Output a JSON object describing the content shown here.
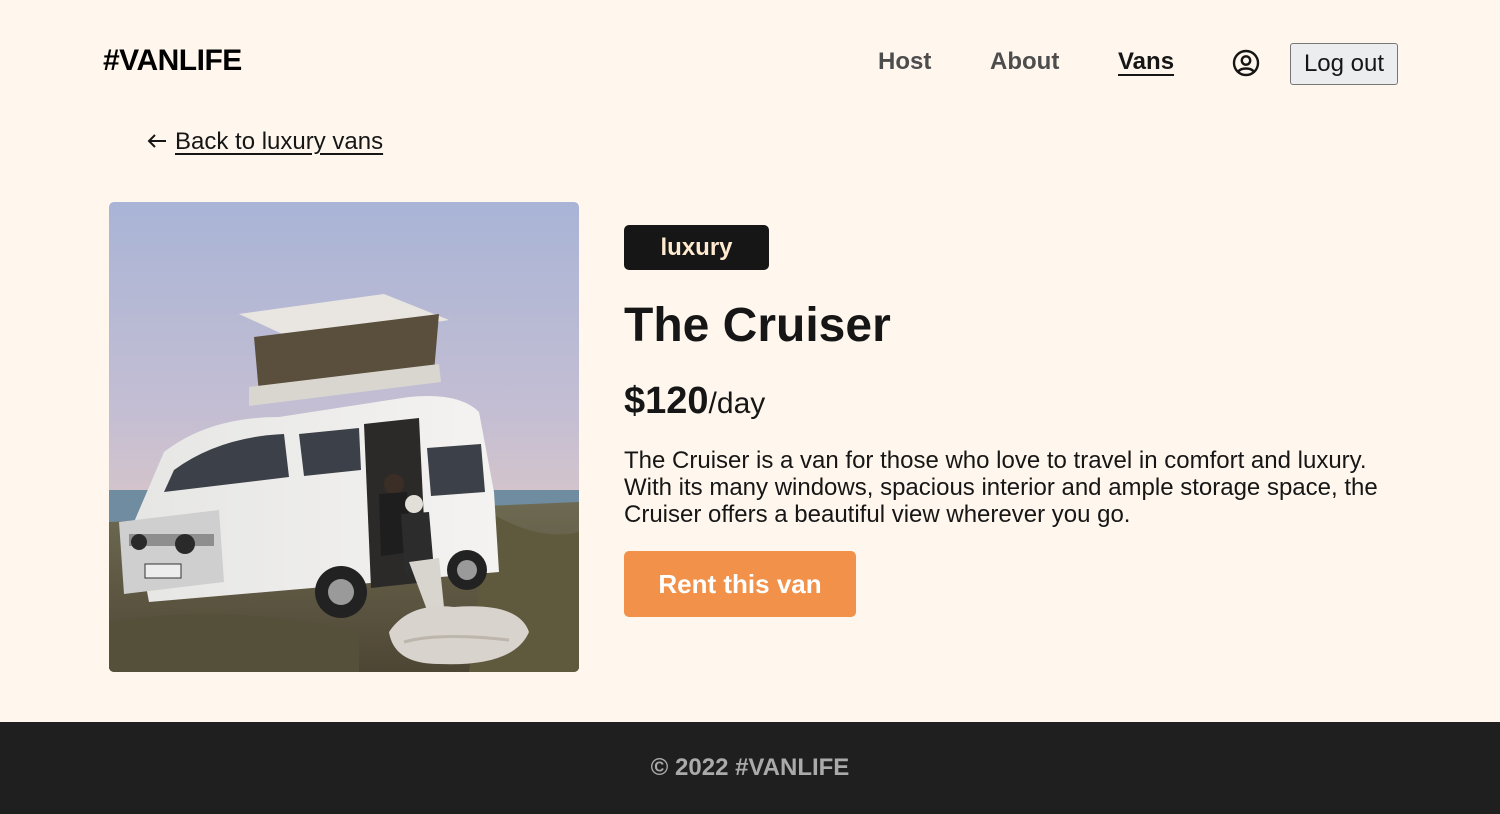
{
  "header": {
    "logo": "#VANLIFE",
    "nav": {
      "host": "Host",
      "about": "About",
      "vans": "Vans",
      "active": "Vans"
    },
    "avatar_icon": "user-circle-icon",
    "logout_label": "Log out"
  },
  "back_link": {
    "icon": "arrow-left-icon",
    "label": "Back to luxury vans"
  },
  "van": {
    "image_icon": "van-photo",
    "type": "luxury",
    "name": "The Cruiser",
    "price": "$120",
    "price_unit": "/day",
    "description": "The Cruiser is a van for those who love to travel in comfort and luxury. With its many windows, spacious interior and ample storage space, the Cruiser offers a beautiful view wherever you go.",
    "cta_label": "Rent this van"
  },
  "footer": {
    "text": "© 2022 #VANLIFE"
  },
  "colors": {
    "background": "#FFF7ED",
    "accent": "#F1914A",
    "badge_bg": "#161616",
    "badge_text": "#FFEAD0",
    "footer_bg": "#1F1F1F"
  }
}
